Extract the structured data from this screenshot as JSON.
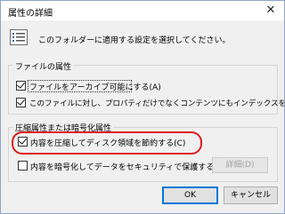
{
  "window": {
    "title": "属性の詳細",
    "close_glyph": "✕"
  },
  "header": {
    "icon": "attributes-list-icon",
    "text": "このフォルダーに適用する設定を選択してください。"
  },
  "file_attributes": {
    "title": "ファイルの属性",
    "archive": {
      "label": "ファイルをアーカイブ可能にする(A)",
      "checked": true
    },
    "index": {
      "label": "このファイルに対し、プロパティだけでなくコンテンツにもインデックスを付ける(I)",
      "checked": true
    }
  },
  "compress_encrypt": {
    "title": "圧縮属性または暗号化属性",
    "compress": {
      "label": "内容を圧縮してディスク領域を節約する(C)",
      "checked": true
    },
    "encrypt": {
      "label": "内容を暗号化してデータをセキュリティで保護する(E)",
      "checked": false
    },
    "details_label": "詳細(D)"
  },
  "buttons": {
    "ok": "OK",
    "cancel": "キャンセル"
  },
  "colors": {
    "highlight": "#e01a1a",
    "primary_border": "#0078d7"
  }
}
